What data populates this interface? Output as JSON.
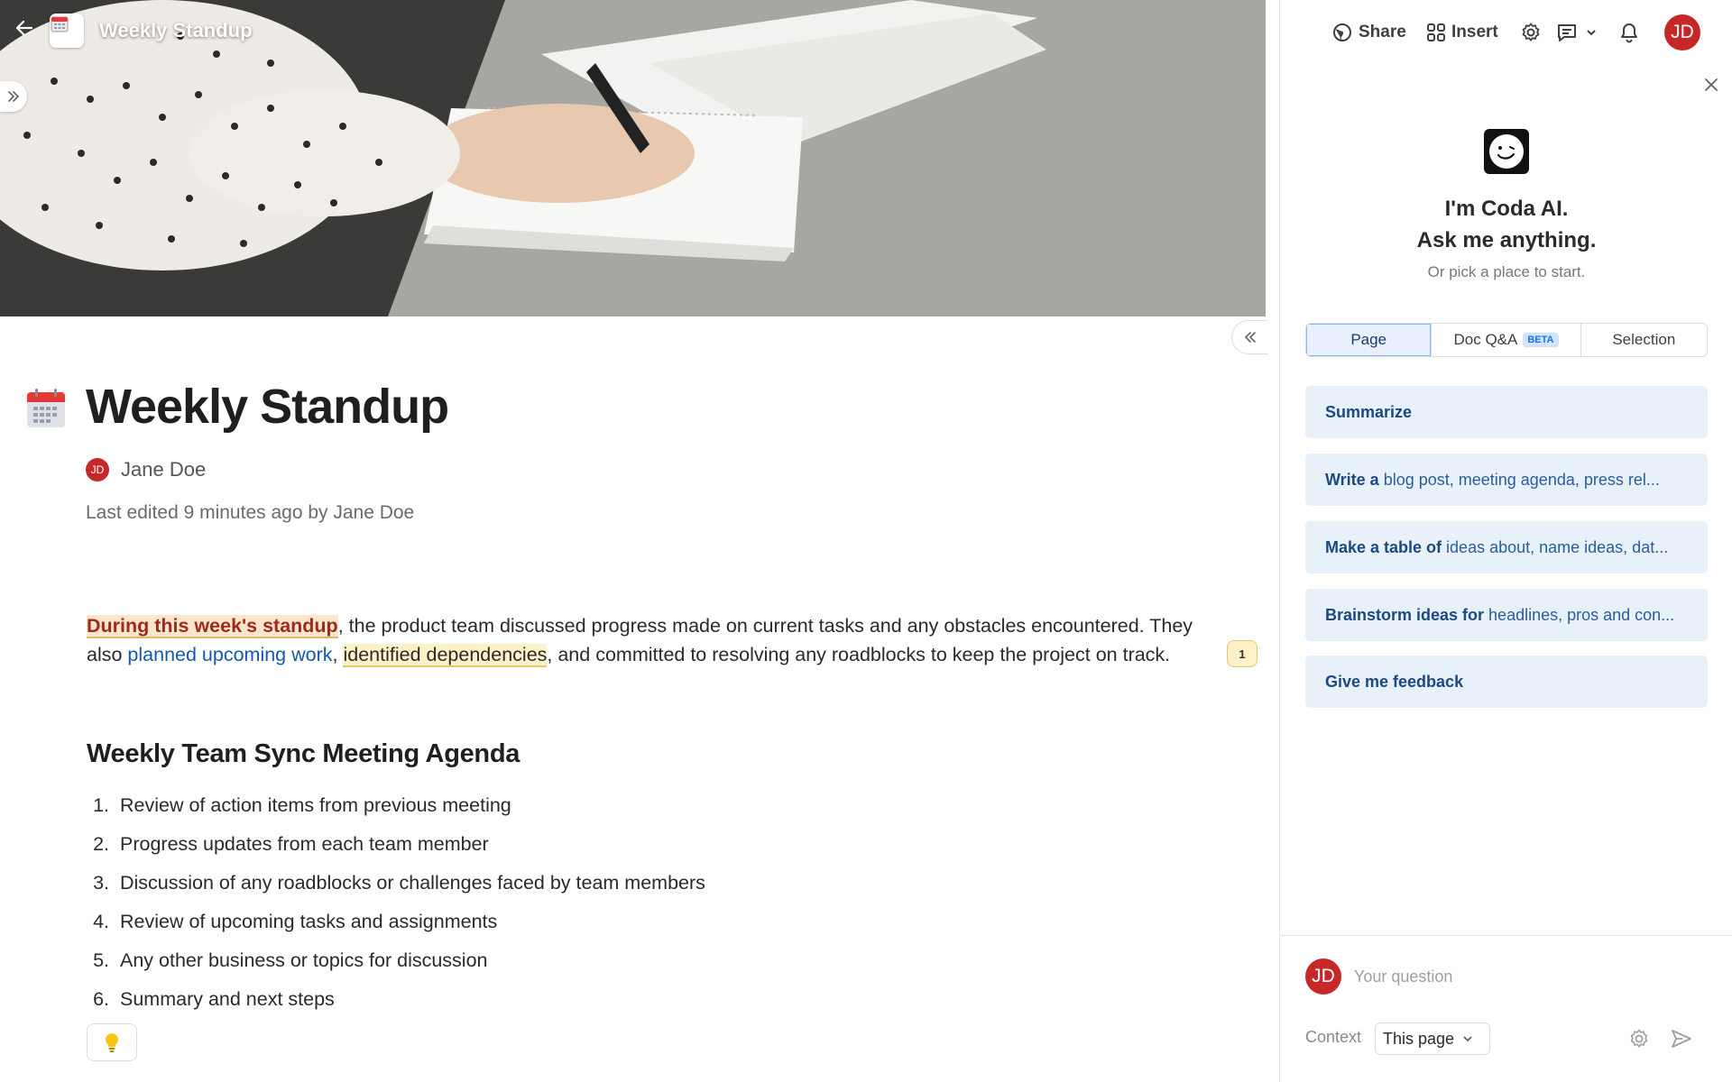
{
  "document": {
    "small_title": "Weekly Standup",
    "title": "Weekly Standup",
    "author": {
      "initials": "JD",
      "name": "Jane Doe"
    },
    "last_edited": "Last edited 9 minutes ago by Jane Doe",
    "paragraph": {
      "highlight_1": "During this week's standup",
      "text_1": ", the product team discussed progress made on current tasks and any obstacles encountered. They also ",
      "link": "planned upcoming work",
      "text_2": ", ",
      "highlight_2": "identified dependencies",
      "text_3": ", and committed to resolving any roadblocks to keep the project on track."
    },
    "comment_count": "1",
    "agenda_title": "Weekly Team Sync Meeting Agenda",
    "agenda_items": [
      {
        "num": "1.",
        "text": "Review of action items from previous meeting"
      },
      {
        "num": "2.",
        "text": "Progress updates from each team member"
      },
      {
        "num": "3.",
        "text": "Discussion of any roadblocks or challenges faced by team members"
      },
      {
        "num": "4.",
        "text": "Review of upcoming tasks and assignments"
      },
      {
        "num": "5.",
        "text": "Any other business or topics for discussion"
      },
      {
        "num": "6.",
        "text": "Summary and next steps"
      }
    ]
  },
  "panel": {
    "share_label": "Share",
    "insert_label": "Insert",
    "user_initials": "JD",
    "ai_title_line1": "I'm Coda AI.",
    "ai_title_line2": "Ask me anything.",
    "ai_subtitle": "Or pick a place to start.",
    "tabs": [
      {
        "label": "Page",
        "active": true
      },
      {
        "label": "Doc Q&A",
        "badge": "BETA"
      },
      {
        "label": "Selection"
      }
    ],
    "suggestions": [
      {
        "bold": "Summarize",
        "rest": ""
      },
      {
        "bold": "Write a",
        "rest": "blog post, meeting agenda, press rel..."
      },
      {
        "bold": "Make a table of",
        "rest": "ideas about, name ideas, dat..."
      },
      {
        "bold": "Brainstorm ideas for",
        "rest": "headlines, pros and con..."
      },
      {
        "bold": "Give me feedback",
        "rest": ""
      }
    ],
    "question_placeholder": "Your question",
    "context_label": "Context",
    "context_value": "This page"
  },
  "colors": {
    "accent": "#1a73e8",
    "avatar": "#c62828",
    "suggestion_bg": "#e8f0fa"
  }
}
